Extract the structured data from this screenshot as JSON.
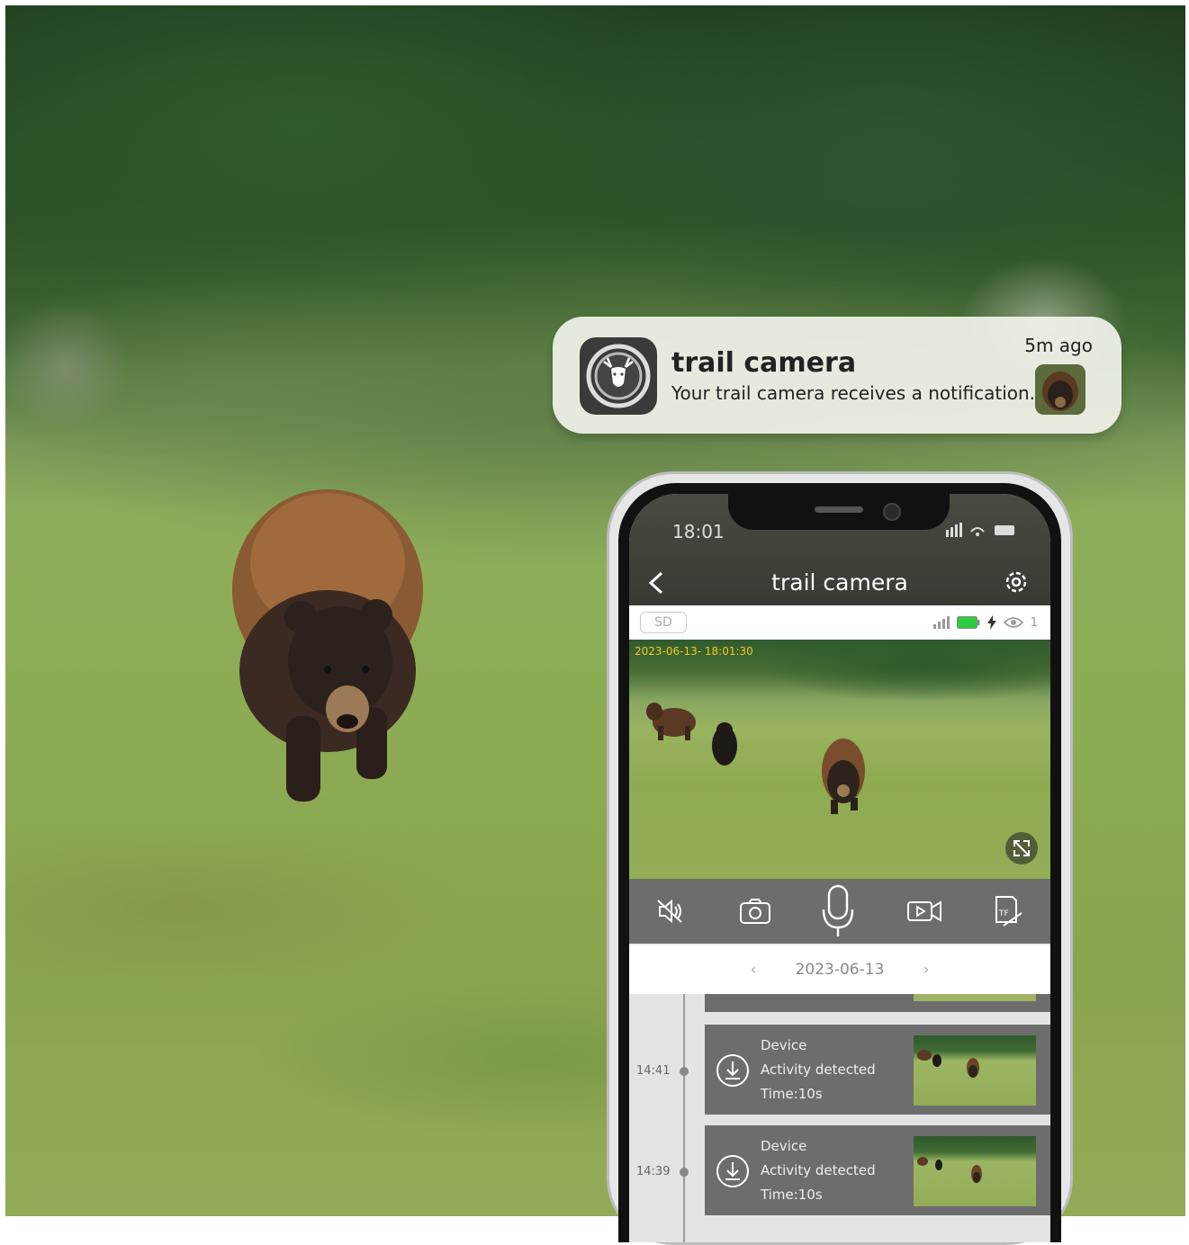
{
  "notification": {
    "app_name": "trail camera",
    "message": "Your trail camera receives a notification.",
    "time": "5m ago"
  },
  "phone": {
    "clock": "18:01",
    "app_title": "trail camera",
    "storage_badge": "SD",
    "viewer_count": "1",
    "video_timestamp": "2023-06-13- 18:01:30",
    "date_selector": "2023-06-13",
    "events": [
      {
        "time": "14:41",
        "source": "Device",
        "activity": "Activity detected",
        "duration": "Time:10s"
      },
      {
        "time": "14:39",
        "source": "Device",
        "activity": "Activity detected",
        "duration": "Time:10s"
      }
    ]
  },
  "colors": {
    "timestamp_yellow": "#f2c91c",
    "battery_green": "#2ecc40",
    "toolbar_gray": "#6d6d6d"
  },
  "icons": [
    "deer-app-icon",
    "back-arrow-icon",
    "gear-icon",
    "mute-icon",
    "snapshot-icon",
    "microphone-icon",
    "record-video-icon",
    "tf-card-icon",
    "download-icon",
    "fullscreen-icon"
  ]
}
